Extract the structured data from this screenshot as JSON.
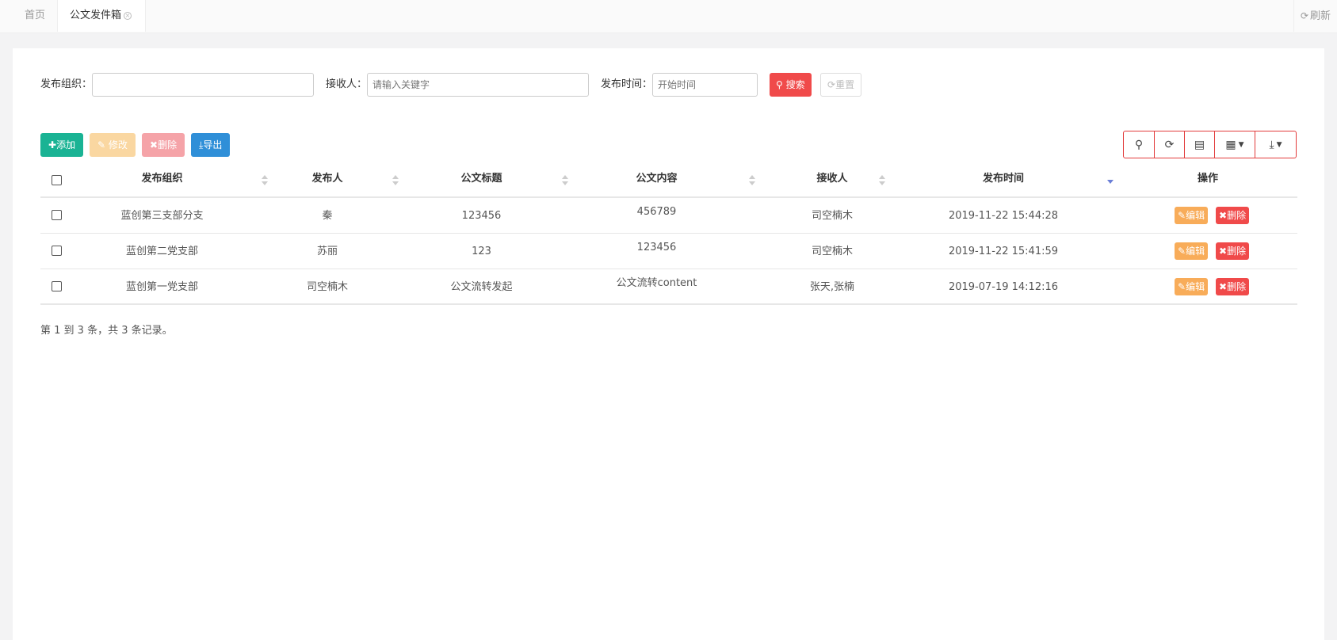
{
  "tabs": {
    "home": "首页",
    "active": "公文发件箱",
    "refresh": "刷新"
  },
  "search": {
    "org_label": "发布组织：",
    "org_value": "",
    "receiver_label": "接收人：",
    "receiver_placeholder": "请输入关键字",
    "time_label": "发布时间：",
    "time_placeholder": "开始时间",
    "search_btn": "搜索",
    "reset_btn": "重置"
  },
  "toolbar": {
    "add": "添加",
    "edit": "修改",
    "delete": "删除",
    "export": "导出"
  },
  "table": {
    "columns": [
      "发布组织",
      "发布人",
      "公文标题",
      "公文内容",
      "接收人",
      "发布时间",
      "操作"
    ],
    "rows": [
      {
        "org": "蓝创第三支部分支",
        "publisher": "秦",
        "title": "123456",
        "content": "456789",
        "receiver": "司空楠木",
        "time": "2019-11-22 15:44:28"
      },
      {
        "org": "蓝创第二党支部",
        "publisher": "苏丽",
        "title": "123",
        "content": "123456",
        "receiver": "司空楠木",
        "time": "2019-11-22 15:41:59"
      },
      {
        "org": "蓝创第一党支部",
        "publisher": "司空楠木",
        "title": "公文流转发起",
        "content": "公文流转content",
        "receiver": "张天,张楠",
        "time": "2019-07-19 14:12:16"
      }
    ],
    "row_edit": "编辑",
    "row_delete": "删除"
  },
  "pagination": "第 1 到 3 条，共 3 条记录。",
  "colors": {
    "add": "#1ab394",
    "edit": "#f8ac59",
    "delete": "#f04a4a",
    "export": "#2f8fd8"
  }
}
